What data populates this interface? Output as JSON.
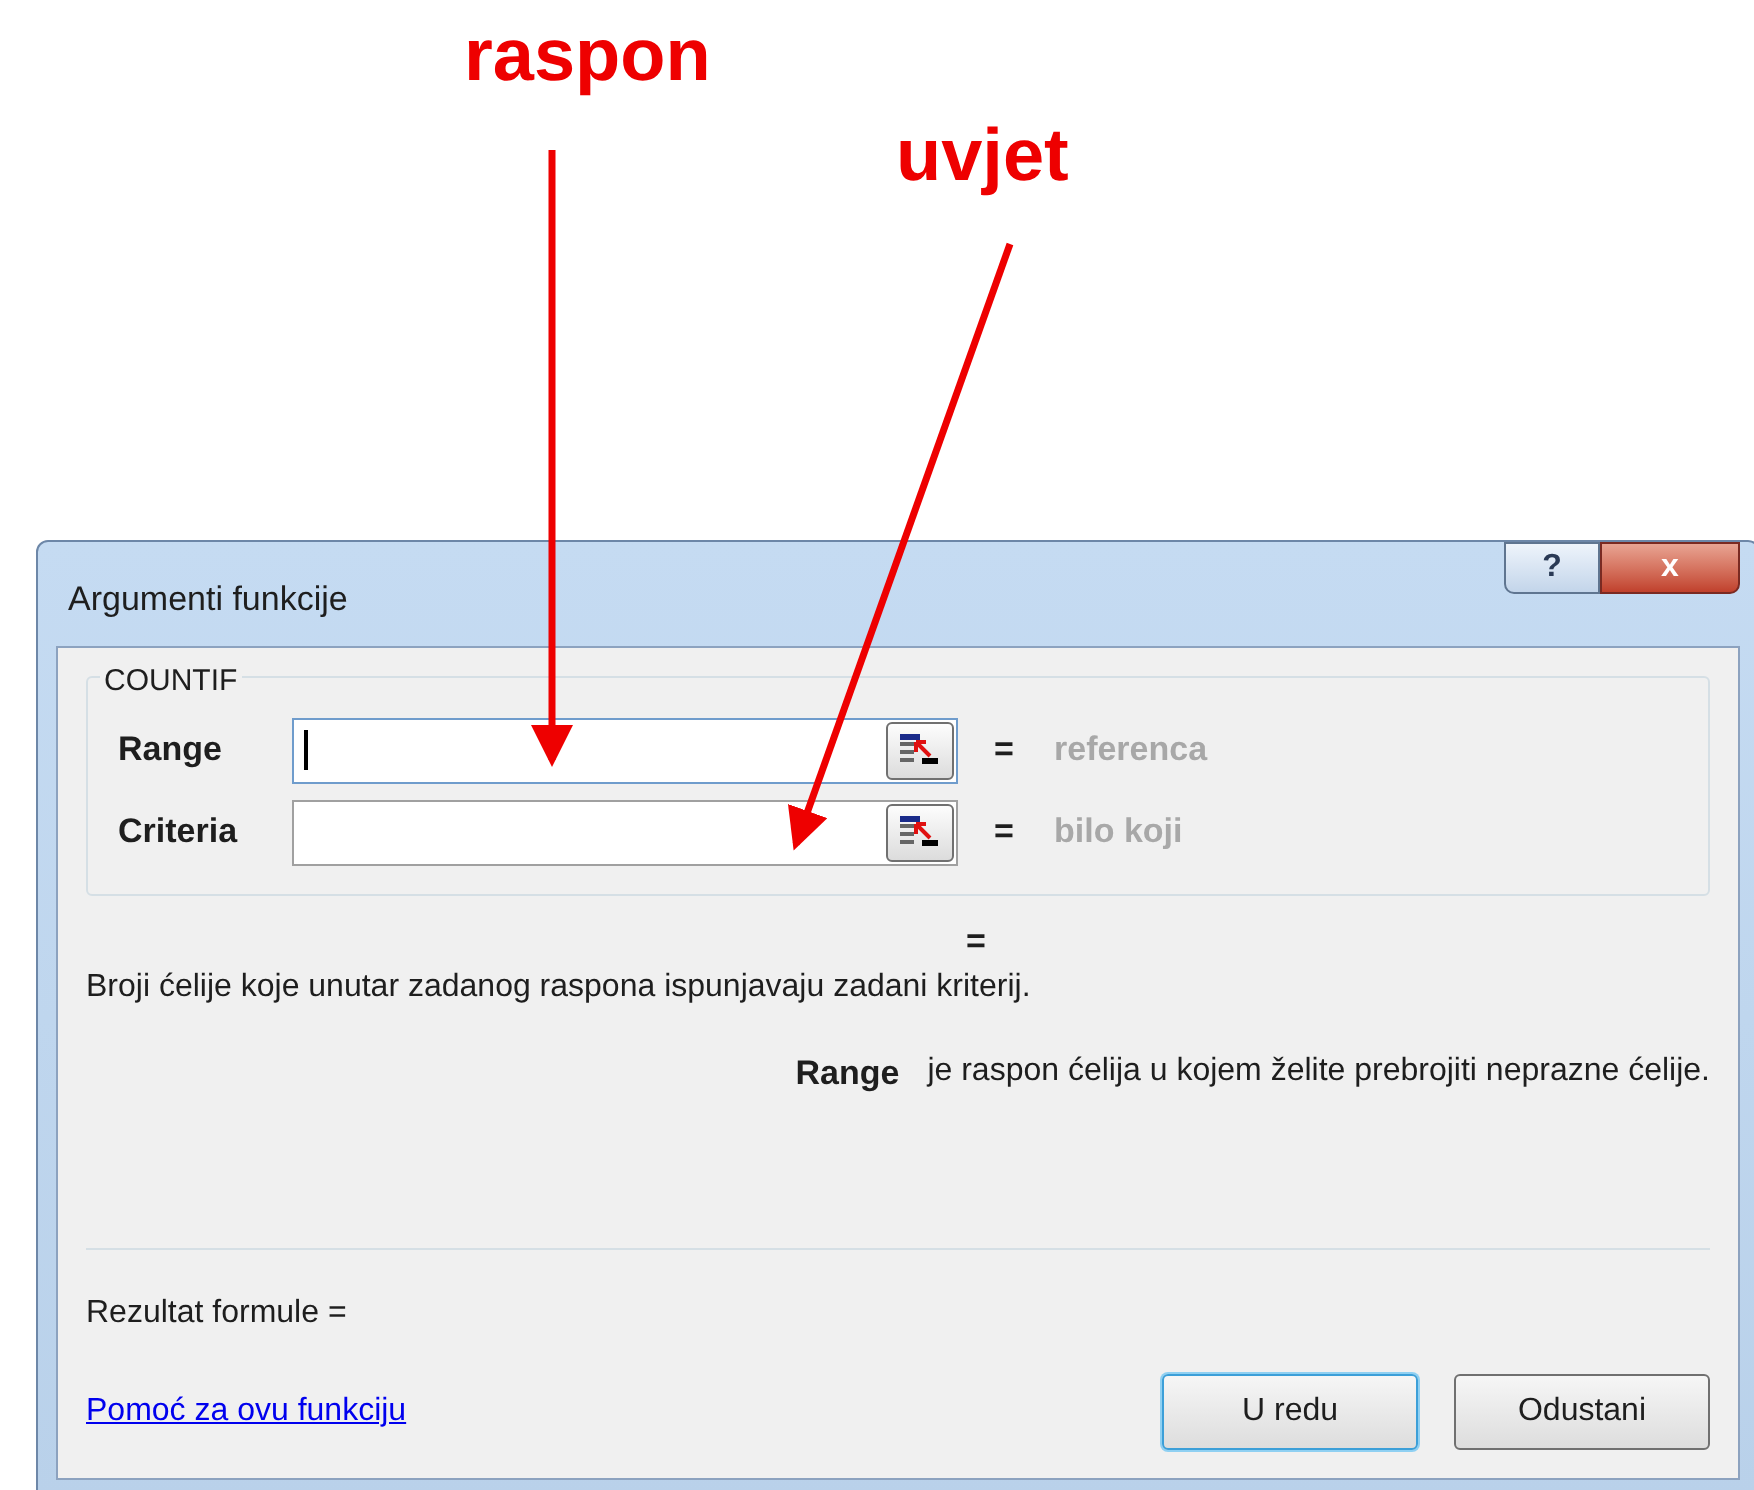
{
  "annotations": [
    {
      "text": "raspon"
    },
    {
      "text": "uvjet"
    }
  ],
  "window": {
    "title": "Argumenti funkcije",
    "help_button": "?",
    "close_button": "x"
  },
  "function_group": {
    "name": "COUNTIF",
    "arguments": [
      {
        "label": "Range",
        "focused": true,
        "equals": "=",
        "result": "referenca"
      },
      {
        "label": "Criteria",
        "focused": false,
        "equals": "=",
        "result": "bilo koji"
      }
    ]
  },
  "overall_equals": "=",
  "description": "Broji ćelije koje unutar zadanog raspona ispunjavaju zadani kriterij.",
  "argument_help": {
    "name": "Range",
    "text": "je raspon ćelija u kojem želite prebrojiti neprazne ćelije."
  },
  "formula_result": "Rezultat formule =",
  "help_link": "Pomoć za ovu funkciju",
  "buttons": [
    {
      "label": "U redu",
      "default": true
    },
    {
      "label": "Odustani",
      "default": false
    }
  ]
}
